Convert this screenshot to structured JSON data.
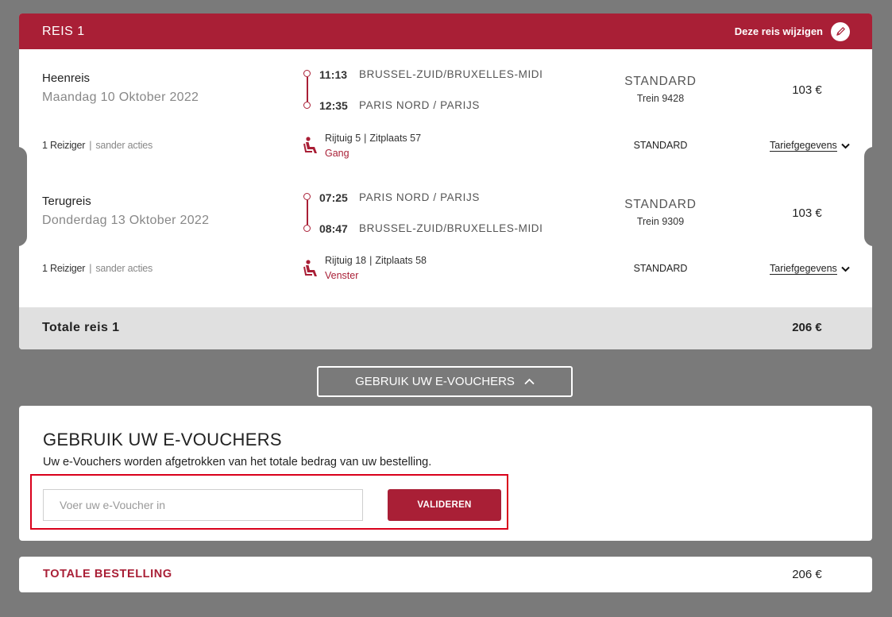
{
  "trip": {
    "title": "REIS 1",
    "modify_label": "Deze reis wijzigen",
    "legs": [
      {
        "title": "Heenreis",
        "date": "Maandag 10 Oktober 2022",
        "dep_time": "11:13",
        "dep_station": "BRUSSEL-ZUID/BRUXELLES-MIDI",
        "arr_time": "12:35",
        "arr_station": "PARIS NORD / PARIJS",
        "class": "STANDARD",
        "train": "Trein 9428",
        "price": "103 €",
        "travellers": "1 Reiziger",
        "travellers_note": "sander acties",
        "coach": "Rijtuig 5",
        "seat": "Zitplaats 57",
        "seat_type": "Gang",
        "class_small": "STANDARD",
        "tariff_label": "Tariefgegevens"
      },
      {
        "title": "Terugreis",
        "date": "Donderdag 13 Oktober 2022",
        "dep_time": "07:25",
        "dep_station": "PARIS NORD / PARIJS",
        "arr_time": "08:47",
        "arr_station": "BRUSSEL-ZUID/BRUXELLES-MIDI",
        "class": "STANDARD",
        "train": "Trein 9309",
        "price": "103 €",
        "travellers": "1 Reiziger",
        "travellers_note": "sander acties",
        "coach": "Rijtuig 18",
        "seat": "Zitplaats 58",
        "seat_type": "Venster",
        "class_small": "STANDARD",
        "tariff_label": "Tariefgegevens"
      }
    ],
    "total_label": "Totale reis 1",
    "total_value": "206 €"
  },
  "voucher_toggle": {
    "label": "GEBRUIK UW E-VOUCHERS"
  },
  "voucher": {
    "title": "GEBRUIK UW E-VOUCHERS",
    "subtitle": "Uw e-Vouchers worden afgetrokken van het totale bedrag van uw bestelling.",
    "input_placeholder": "Voer uw e-Voucher in",
    "button_label": "VALIDEREN"
  },
  "order": {
    "label": "TOTALE BESTELLING",
    "value": "206 €"
  },
  "colors": {
    "brand": "#a91f36",
    "background": "#7a7a7a",
    "highlight": "#d9001b"
  },
  "icons": [
    "pencil-icon",
    "seat-icon",
    "chevron-down-icon",
    "chevron-up-icon"
  ]
}
